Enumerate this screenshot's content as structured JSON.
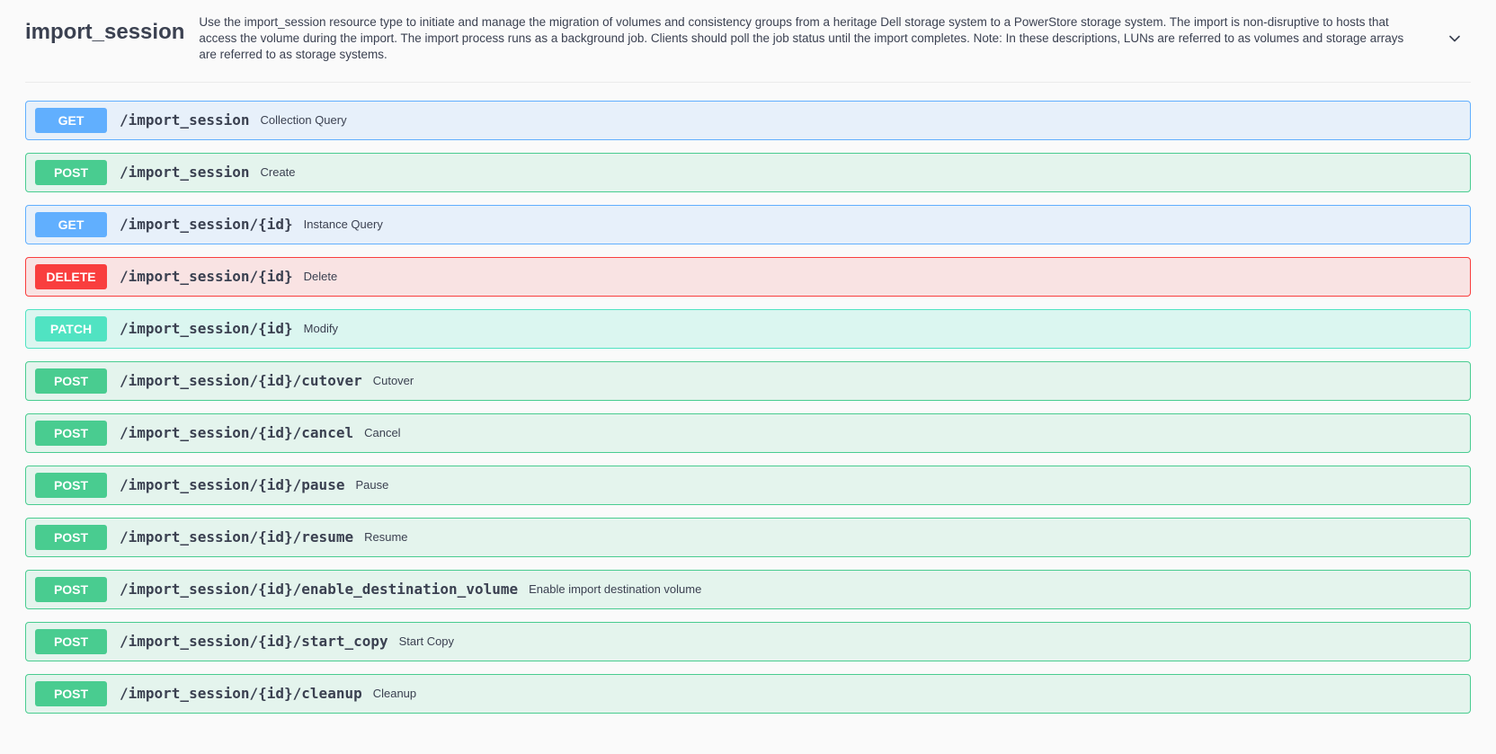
{
  "tag": {
    "name": "import_session",
    "description": "Use the import_session resource type to initiate and manage the migration of volumes and consistency groups from a heritage Dell storage system to a PowerStore storage system. The import is non-disruptive to hosts that access the volume during the import. The import process runs as a background job. Clients should poll the job status until the import completes. Note: In these descriptions, LUNs are referred to as volumes and storage arrays are referred to as storage systems."
  },
  "operations": [
    {
      "method": "GET",
      "path": "/import_session",
      "summary": "Collection Query"
    },
    {
      "method": "POST",
      "path": "/import_session",
      "summary": "Create"
    },
    {
      "method": "GET",
      "path": "/import_session/{id}",
      "summary": "Instance Query"
    },
    {
      "method": "DELETE",
      "path": "/import_session/{id}",
      "summary": "Delete"
    },
    {
      "method": "PATCH",
      "path": "/import_session/{id}",
      "summary": "Modify"
    },
    {
      "method": "POST",
      "path": "/import_session/{id}/cutover",
      "summary": "Cutover"
    },
    {
      "method": "POST",
      "path": "/import_session/{id}/cancel",
      "summary": "Cancel"
    },
    {
      "method": "POST",
      "path": "/import_session/{id}/pause",
      "summary": "Pause"
    },
    {
      "method": "POST",
      "path": "/import_session/{id}/resume",
      "summary": "Resume"
    },
    {
      "method": "POST",
      "path": "/import_session/{id}/enable_destination_volume",
      "summary": "Enable import destination volume"
    },
    {
      "method": "POST",
      "path": "/import_session/{id}/start_copy",
      "summary": "Start Copy"
    },
    {
      "method": "POST",
      "path": "/import_session/{id}/cleanup",
      "summary": "Cleanup"
    }
  ],
  "colors": {
    "get": "#61affe",
    "post": "#49cc90",
    "delete": "#f93e3e",
    "patch": "#50e3c2"
  }
}
